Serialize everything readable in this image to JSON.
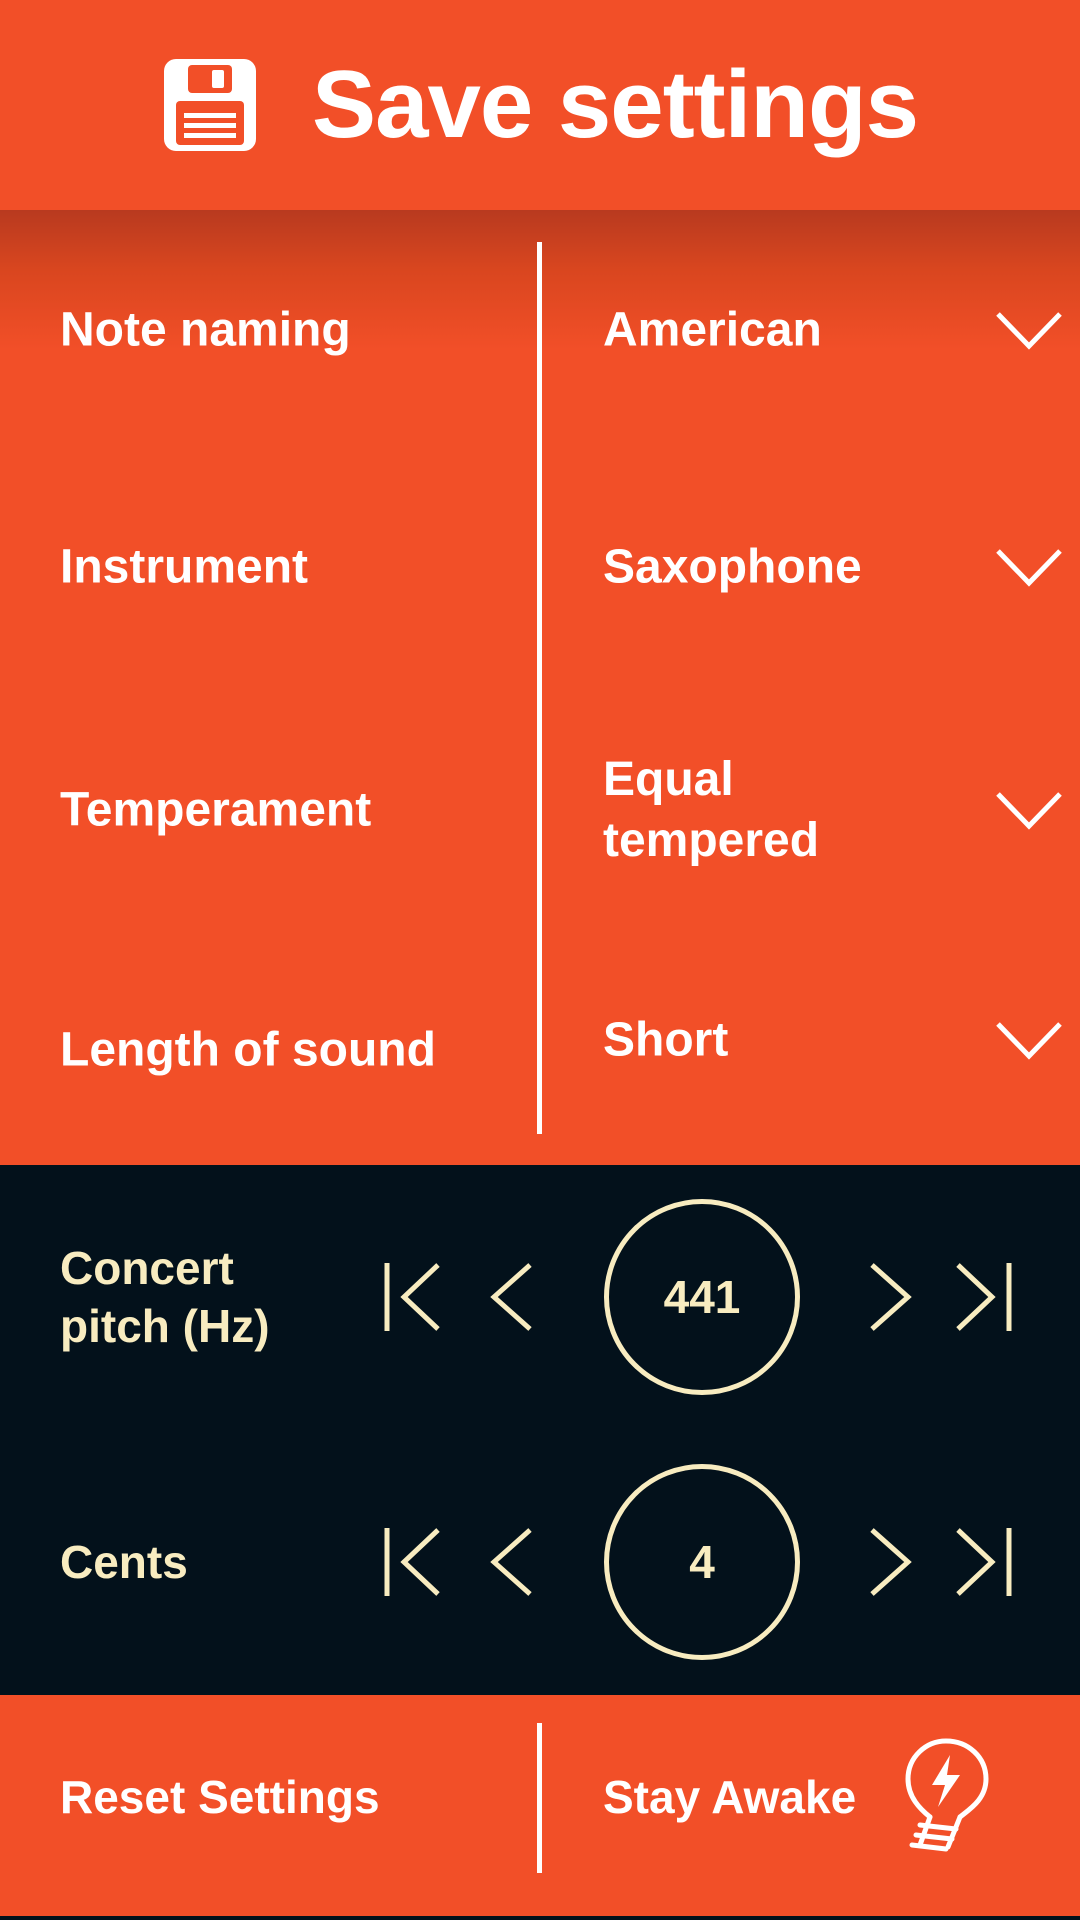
{
  "header": {
    "title": "Save settings",
    "icon": "floppy-disk-icon"
  },
  "settings": [
    {
      "label": "Note naming",
      "value": "American"
    },
    {
      "label": "Instrument",
      "value": "Saxophone"
    },
    {
      "label": "Temperament",
      "value": "Equal tempered"
    },
    {
      "label": "Length of sound",
      "value": "Short"
    }
  ],
  "pitch": {
    "concert_label": "Concert pitch (Hz)",
    "concert_value": "441",
    "cents_label": "Cents",
    "cents_value": "4"
  },
  "footer": {
    "reset_label": "Reset Settings",
    "awake_label": "Stay Awake",
    "awake_icon": "lightbulb-bolt-icon"
  },
  "colors": {
    "accent": "#f24f28",
    "dark": "#03111b",
    "cream": "#f8ecc0",
    "white": "#ffffff"
  }
}
